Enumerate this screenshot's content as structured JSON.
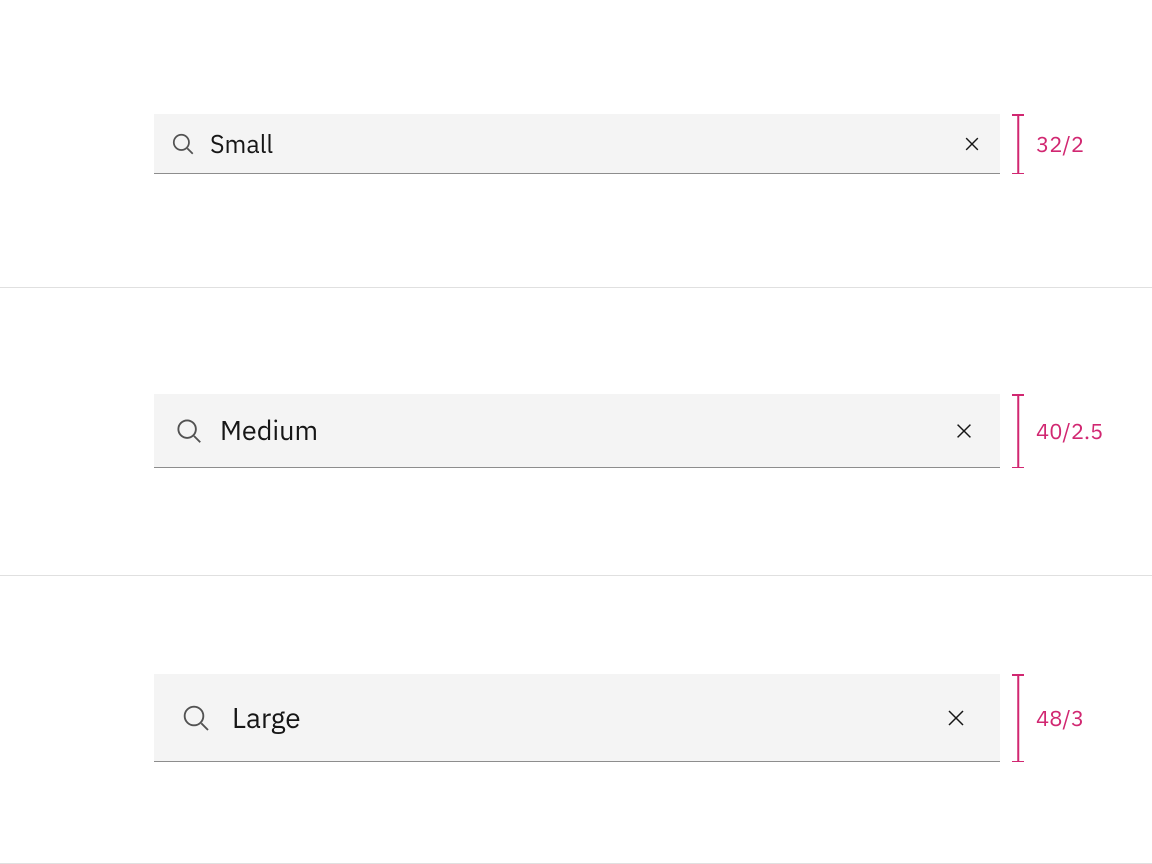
{
  "spec_color": "#d12771",
  "sizes": {
    "small": {
      "value": "Small",
      "dim_label": "32/2"
    },
    "medium": {
      "value": "Medium",
      "dim_label": "40/2.5"
    },
    "large": {
      "value": "Large",
      "dim_label": "48/3"
    }
  },
  "icons": {
    "search": "search-icon",
    "close": "close-icon"
  }
}
